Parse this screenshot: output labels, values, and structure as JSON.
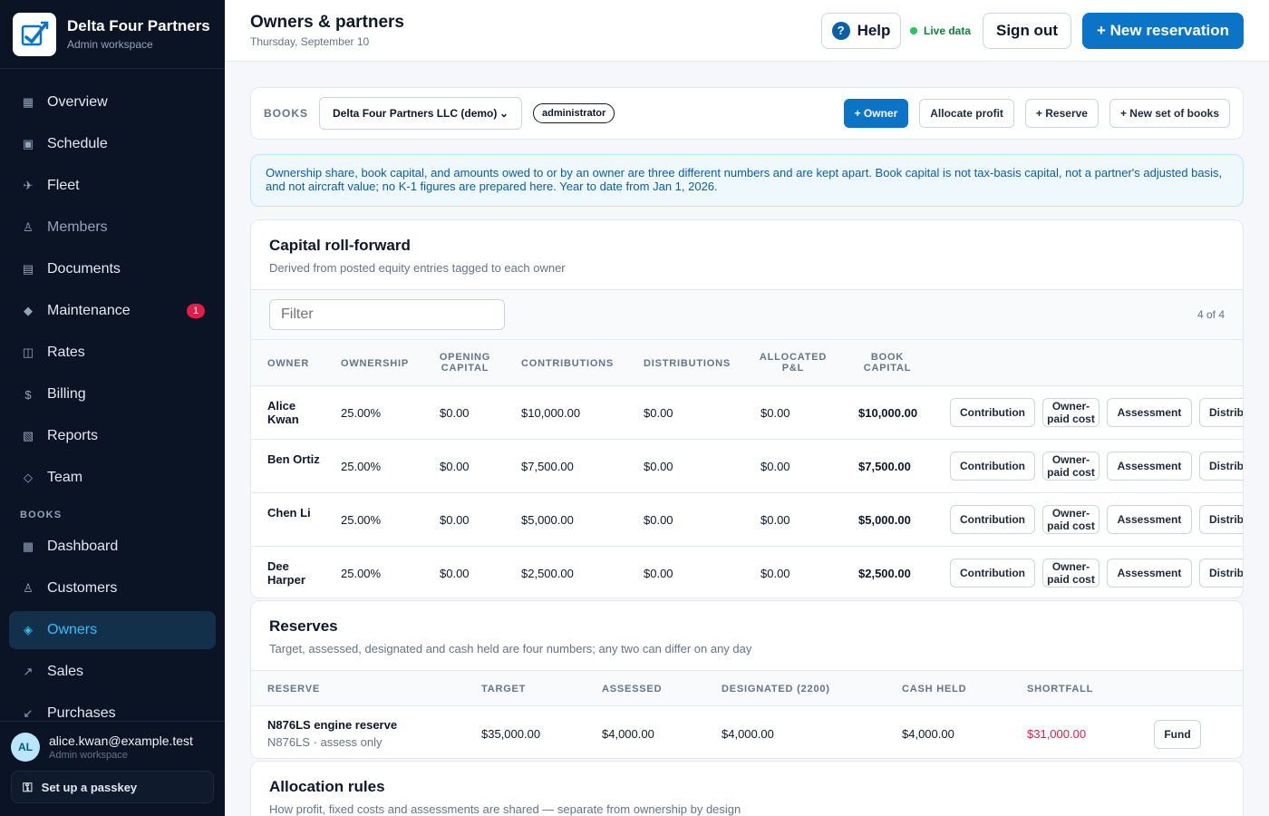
{
  "brand": {
    "name": "Delta Four Partners",
    "subtitle": "Admin workspace"
  },
  "nav": {
    "items": [
      {
        "label": "Overview",
        "icon": "grid-icon"
      },
      {
        "label": "Schedule",
        "icon": "calendar-icon"
      },
      {
        "label": "Fleet",
        "icon": "plane-icon"
      },
      {
        "label": "Members",
        "icon": "person-icon"
      },
      {
        "label": "Documents",
        "icon": "document-icon"
      },
      {
        "label": "Maintenance",
        "icon": "wrench-icon",
        "badge": "1"
      },
      {
        "label": "Rates",
        "icon": "rates-icon"
      },
      {
        "label": "Billing",
        "icon": "dollar-icon"
      },
      {
        "label": "Reports",
        "icon": "reports-icon"
      },
      {
        "label": "Team",
        "icon": "team-icon"
      }
    ],
    "section_label": "BOOKS",
    "book_items": [
      {
        "label": "Dashboard",
        "icon": "grid-icon"
      },
      {
        "label": "Customers",
        "icon": "person-icon"
      },
      {
        "label": "Owners",
        "icon": "owners-icon",
        "active": true
      },
      {
        "label": "Sales",
        "icon": "arrow-up-right-icon"
      },
      {
        "label": "Purchases",
        "icon": "arrow-down-left-icon"
      }
    ]
  },
  "user": {
    "initials": "AL",
    "email": "alice.kwan@example.test",
    "role": "Admin workspace",
    "passkey_label": "Set up a passkey"
  },
  "header": {
    "title": "Owners & partners",
    "date": "Thursday, September 10",
    "help_label": "Help",
    "live_label": "Live data",
    "signout_label": "Sign out",
    "new_reservation_label": "+  New reservation"
  },
  "books_bar": {
    "label": "BOOKS",
    "selected_book": "Delta Four Partners LLC (demo)",
    "role_pill": "administrator",
    "actions": {
      "owner": "+ Owner",
      "allocate": "Allocate profit",
      "reserve": "+ Reserve",
      "new_books": "+ New set of books"
    }
  },
  "info_text": "Ownership share, book capital, and amounts owed to or by an owner are three different numbers and are kept apart. Book capital is not tax-basis capital, not a partner's adjusted basis, and not aircraft value; no K-1 figures are prepared here. Year to date from Jan 1, 2026.",
  "capital": {
    "title": "Capital roll-forward",
    "subtitle": "Derived from posted equity entries tagged to each owner",
    "filter_placeholder": "Filter",
    "count": "4 of 4",
    "columns": {
      "owner": "OWNER",
      "ownership": "OWNERSHIP",
      "opening": "OPENING CAPITAL",
      "contributions": "CONTRIBUTIONS",
      "distributions": "DISTRIBUTIONS",
      "allocated": "ALLOCATED P&L",
      "book": "BOOK CAPITAL"
    },
    "row_actions": {
      "contribution": "Contribution",
      "owner_paid": "Owner-paid cost",
      "assessment": "Assessment",
      "distribution": "Distrib"
    },
    "rows": [
      {
        "owner": "Alice Kwan",
        "ownership": "25.00%",
        "opening": "$0.00",
        "contributions": "$10,000.00",
        "distributions": "$0.00",
        "allocated": "$0.00",
        "book": "$10,000.00"
      },
      {
        "owner": "Ben Ortiz",
        "ownership": "25.00%",
        "opening": "$0.00",
        "contributions": "$7,500.00",
        "distributions": "$0.00",
        "allocated": "$0.00",
        "book": "$7,500.00"
      },
      {
        "owner": "Chen Li",
        "ownership": "25.00%",
        "opening": "$0.00",
        "contributions": "$5,000.00",
        "distributions": "$0.00",
        "allocated": "$0.00",
        "book": "$5,000.00"
      },
      {
        "owner": "Dee Harper",
        "ownership": "25.00%",
        "opening": "$0.00",
        "contributions": "$2,500.00",
        "distributions": "$0.00",
        "allocated": "$0.00",
        "book": "$2,500.00"
      }
    ]
  },
  "reserves": {
    "title": "Reserves",
    "subtitle": "Target, assessed, designated and cash held are four numbers; any two can differ on any day",
    "columns": {
      "reserve": "RESERVE",
      "target": "TARGET",
      "assessed": "ASSESSED",
      "designated": "DESIGNATED (2200)",
      "cash": "CASH HELD",
      "shortfall": "SHORTFALL"
    },
    "rows": [
      {
        "name": "N876LS engine reserve",
        "detail": "N876LS · assess only",
        "target": "$35,000.00",
        "assessed": "$4,000.00",
        "designated": "$4,000.00",
        "cash": "$4,000.00",
        "shortfall": "$31,000.00",
        "action": "Fund"
      }
    ]
  },
  "allocation": {
    "title": "Allocation rules",
    "subtitle": "How profit, fixed costs and assessments are shared — separate from ownership by design"
  },
  "colors": {
    "accent": "#0b74c7",
    "sidebar_bg": "#0b1424",
    "active_nav": "#38bdf8",
    "danger": "#e11d48",
    "live": "#22c55e"
  }
}
